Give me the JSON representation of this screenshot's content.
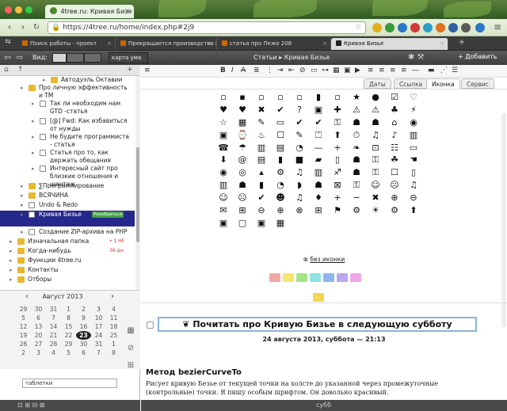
{
  "window": {
    "tab_title": "4tree.ru: Кривая Бизе",
    "url": "https://4tree.ru/home/index.php#2j9"
  },
  "tabs": [
    {
      "label": "Поиск работы - проект"
    },
    {
      "label": "Прекращается производство Fo…"
    },
    {
      "label": "статья про Пежо 208"
    },
    {
      "label": "Кривая Бизье"
    }
  ],
  "app_toolbar": {
    "view_label": "Вид:",
    "map_label": "карта ума",
    "breadcrumbs": "Статьи ▸ Кривая Бизье",
    "add_label": "+ Добавить"
  },
  "tree": [
    {
      "text": "Автодуэль Октавии",
      "indent": 64,
      "icon": "folder"
    },
    {
      "text": "Про личную эффективность\nи ТМ",
      "indent": 36,
      "icon": "folder"
    },
    {
      "text": "Так ли необходим нам\nGTD -статья",
      "indent": 50,
      "icon": "note"
    },
    {
      "text": "[@] Fwd: Как избавиться\nот нужды",
      "indent": 50,
      "icon": "note"
    },
    {
      "text": "Не будите программиста\n- статья",
      "indent": 50,
      "icon": "note"
    },
    {
      "text": "Статья про то, как\nдержать обещания",
      "indent": 50,
      "icon": "note"
    },
    {
      "text": "Интересный сайт про\nблизкие отношения и шантаж",
      "indent": 50,
      "icon": "note"
    },
    {
      "text": "∑Программирование",
      "indent": 36,
      "icon": "folder"
    },
    {
      "text": "ВСЯЧИНА",
      "indent": 36,
      "icon": "folder"
    },
    {
      "text": "Undo & Redo",
      "indent": 36,
      "icon": "note"
    },
    {
      "text": "Кривая Бизье",
      "indent": 36,
      "icon": "note",
      "badge": "Разобраться",
      "selected": true
    },
    {
      "text": "Создание ZIP-архива на PHP",
      "indent": 36,
      "icon": "note"
    },
    {
      "text": "Изначальная папка",
      "indent": 22,
      "icon": "folder",
      "count": "• 1 HF"
    },
    {
      "text": "Когда-нибудь",
      "indent": 22,
      "icon": "folder",
      "count": "36 дн"
    },
    {
      "text": "Функции 4tree.ru",
      "indent": 22,
      "icon": "folder"
    },
    {
      "text": "Контакты",
      "indent": 22,
      "icon": "folder"
    },
    {
      "text": "Отборы",
      "indent": 22,
      "icon": "folder"
    }
  ],
  "calendar": {
    "month": "Август 2013",
    "rows": [
      [
        "29",
        "30",
        "31",
        "1",
        "2",
        "3",
        "4"
      ],
      [
        "5",
        "6",
        "7",
        "8",
        "9",
        "10",
        "11"
      ],
      [
        "12",
        "13",
        "14",
        "15",
        "16",
        "17",
        "18"
      ],
      [
        "19",
        "20",
        "21",
        "22",
        "23",
        "24",
        "25"
      ],
      [
        "26",
        "27",
        "28",
        "29",
        "30",
        "31",
        "1"
      ],
      [
        "2",
        "3",
        "4",
        "5",
        "6",
        "7",
        "8"
      ]
    ],
    "today": "23"
  },
  "search": {
    "value": "таблетки"
  },
  "editor_tabs": [
    "Даты",
    "Ссылка",
    "Иконка",
    "Сервис"
  ],
  "icons_grid": "▫▪▫▫▫▮▫★●☑♡♥♥✖✔?▣✚⚠⚠♣⚡☆▦✎▭✔✔⚿☗☗⌂◉▣⌚♨☐✎⏍⬆⏱♫♪▥☎☂▥▤◔—+❧⊡☷▭⬇@▤▮■▰▯☗⚿☘☚◉◎▴⚙♫▥♐☗⚿☐▯▥☗▮◔◗☗⊠⚿☺☹♫☺☹✔☻♫♦+−✖⊕⊖✉⊞⊖⊕⊗⊞⚑⚙☀⚙⬆▣▢▣▦",
  "no_icon_label": "без иконки",
  "color_swatches": [
    "#f2a7a7",
    "#f5e66e",
    "#a6e38a",
    "#8fe3e3",
    "#8fb6f0",
    "#b9a7f0",
    "#f0a7e6"
  ],
  "note": {
    "title": "Почитать про Кривую Бизье в следующую субботу",
    "date": "24 августа 2013, суббота — 21:13",
    "heading": "Метод bezierCurveTo",
    "body": "Рисует кривую Безье от текущей точки на холсте до указанной через промежуточные (контрольные) точки. Я пишу особым шрифтом. Он довольно красивый."
  },
  "status": {
    "bottom_label": "субб"
  }
}
